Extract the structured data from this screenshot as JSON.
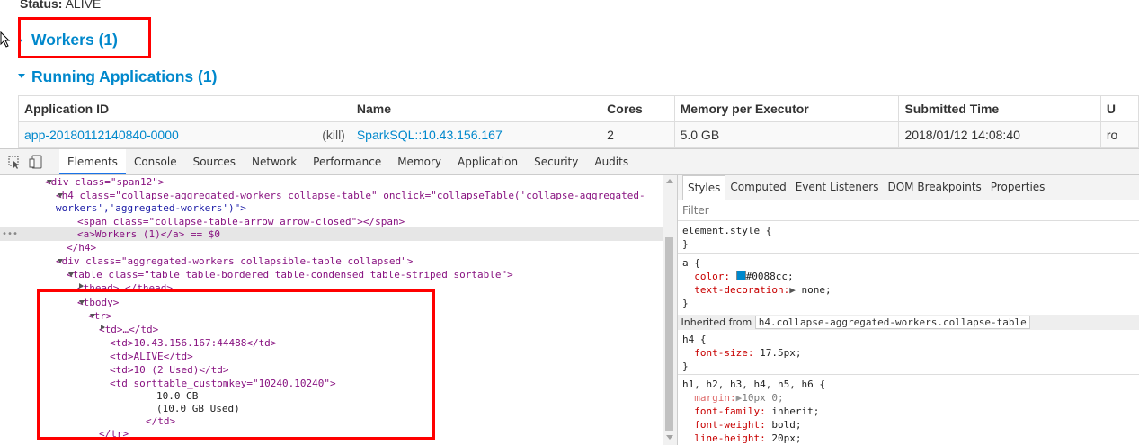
{
  "spark": {
    "status_label": "Status:",
    "status_value": "ALIVE",
    "workers_heading": "Workers (1)",
    "running_heading": "Running Applications (1)",
    "table": {
      "headers": [
        "Application ID",
        "Name",
        "Cores",
        "Memory per Executor",
        "Submitted Time",
        "U"
      ],
      "row": {
        "app_id": "app-20180112140840-0000",
        "kill": "(kill)",
        "name": "SparkSQL::10.43.156.167",
        "cores": "2",
        "memory": "5.0 GB",
        "submitted": "2018/01/12 14:08:40",
        "user": "ro"
      }
    }
  },
  "devtools": {
    "tabs": [
      "Elements",
      "Console",
      "Sources",
      "Network",
      "Performance",
      "Memory",
      "Application",
      "Security",
      "Audits"
    ],
    "active_tab": "Elements",
    "elements_lines": [
      "<div class=\"span12\">",
      "<h4 class=\"collapse-aggregated-workers collapse-table\" onclick=\"collapseTable('collapse-aggregated-",
      "workers','aggregated-workers')\">",
      "<span class=\"collapse-table-arrow arrow-closed\"></span>",
      "<a>Workers (1)</a> == $0",
      "</h4>",
      "<div class=\"aggregated-workers collapsible-table collapsed\">",
      "<table class=\"table table-bordered table-condensed table-striped sortable\">",
      "<thead>…</thead>",
      "<tbody>",
      "<tr>",
      "<td>…</td>",
      "<td>10.43.156.167:44488</td>",
      "<td>ALIVE</td>",
      "<td>10 (2 Used)</td>",
      "<td sorttable_customkey=\"10240.10240\">",
      "10.0 GB",
      "(10.0 GB Used)",
      "</td>",
      "</tr>"
    ],
    "styles": {
      "tabs": [
        "Styles",
        "Computed",
        "Event Listeners",
        "DOM Breakpoints",
        "Properties"
      ],
      "filter_placeholder": "Filter",
      "element_style": "element.style {",
      "close_brace": "}",
      "a_selector": "a {",
      "a_color_prop": "color:",
      "a_color_val": "#0088cc;",
      "a_deco_prop": "text-decoration:",
      "a_deco_val": "none;",
      "inherited_label": "Inherited from",
      "inherited_link": "h4.collapse-aggregated-workers.collapse-table",
      "h4_selector": "h4 {",
      "h4_fs_prop": "font-size:",
      "h4_fs_val": "17.5px;",
      "h_selector": "h1, h2, h3, h4, h5, h6 {",
      "margin_prop": "margin:",
      "margin_val": "10px 0;",
      "ff_prop": "font-family:",
      "ff_val": "inherit;",
      "fw_prop": "font-weight:",
      "fw_val": "bold;",
      "lh_prop": "line-height:",
      "lh_val": "20px;"
    }
  },
  "colors": {
    "link": "#0088cc",
    "highlight_box": "#ff0000"
  }
}
